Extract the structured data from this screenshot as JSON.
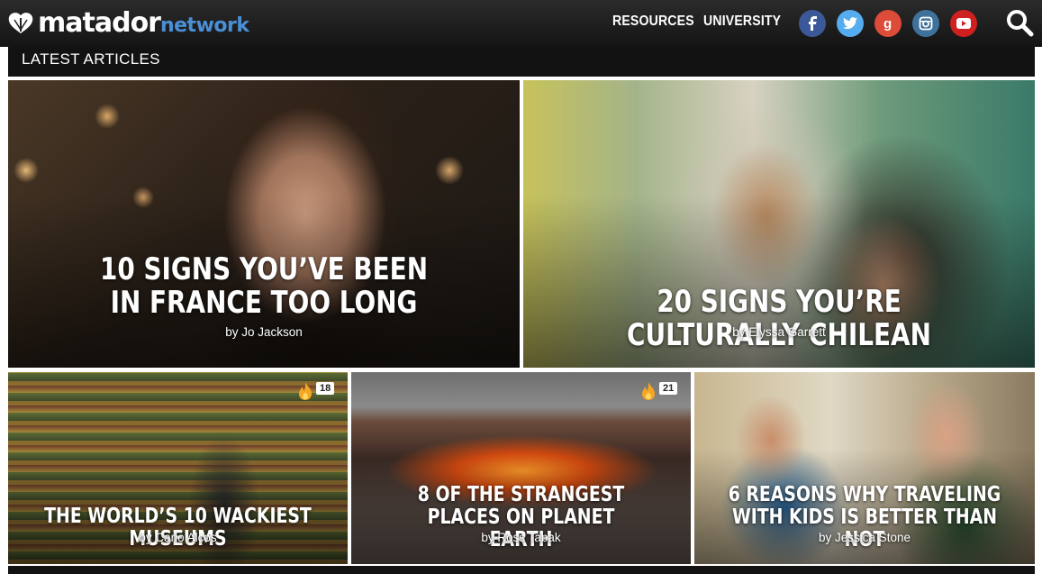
{
  "header": {
    "logo_main": "matador",
    "logo_sub": "network",
    "nav": [
      {
        "label": "RESOURCES"
      },
      {
        "label": "UNIVERSITY"
      }
    ],
    "social": [
      {
        "icon": "facebook-icon",
        "glyph": "f",
        "color": "#3b5998"
      },
      {
        "icon": "twitter-icon",
        "glyph": "t",
        "color": "#55acee"
      },
      {
        "icon": "google-plus-icon",
        "glyph": "g",
        "color": "#dd4b39"
      },
      {
        "icon": "instagram-icon",
        "glyph": "◙",
        "color": "#3f729b"
      },
      {
        "icon": "youtube-icon",
        "glyph": "▶",
        "color": "#cd201f"
      }
    ],
    "search_icon": "search-icon"
  },
  "section": {
    "title": "LATEST ARTICLES"
  },
  "articles": [
    {
      "title": "10 SIGNS YOU’VE BEEN IN FRANCE TOO LONG",
      "byline": "by Jo Jackson",
      "comments": ""
    },
    {
      "title": "20 SIGNS YOU’RE CULTURALLY CHILEAN",
      "byline": "by Elyssa Garrett",
      "comments": ""
    },
    {
      "title": "THE WORLD’S 10 WACKIEST MUSEUMS",
      "byline": "by Carlo Alcos",
      "comments": "18"
    },
    {
      "title": "8 OF THE STRANGEST PLACES ON PLANET EARTH",
      "byline": "by Ross Tabak",
      "comments": "21"
    },
    {
      "title": "6 REASONS WHY TRAVELING WITH KIDS IS BETTER THAN NOT",
      "byline": "by Jessica Stone",
      "comments": ""
    }
  ],
  "colors": {
    "accent": "#4a8fd6",
    "flame": "#f5a623"
  }
}
